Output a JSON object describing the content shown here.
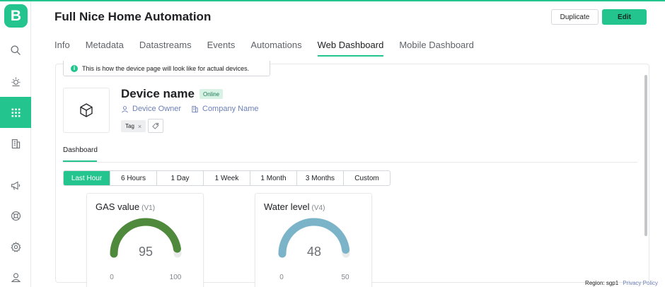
{
  "app": {
    "logo_letter": "B"
  },
  "header": {
    "title": "Full Nice Home Automation",
    "duplicate_label": "Duplicate",
    "edit_label": "Edit"
  },
  "sidebar": {
    "items": [
      {
        "icon": "search-icon"
      },
      {
        "icon": "sun-icon"
      },
      {
        "icon": "grid-icon",
        "active": true
      },
      {
        "icon": "building-icon"
      },
      {
        "icon": "megaphone-icon"
      },
      {
        "icon": "lifebuoy-icon"
      },
      {
        "icon": "gear-icon"
      },
      {
        "icon": "user-icon"
      }
    ],
    "accent": "#23c48e"
  },
  "tabs": [
    {
      "label": "Info"
    },
    {
      "label": "Metadata"
    },
    {
      "label": "Datastreams"
    },
    {
      "label": "Events"
    },
    {
      "label": "Automations"
    },
    {
      "label": "Web Dashboard",
      "active": true
    },
    {
      "label": "Mobile Dashboard"
    }
  ],
  "banner": {
    "text": "This is how the device page will look like for actual devices."
  },
  "device": {
    "name": "Device name",
    "status": "Online",
    "owner": "Device Owner",
    "company": "Company Name",
    "tag": "Tag"
  },
  "dashboard": {
    "tab": "Dashboard",
    "ranges": [
      "Last Hour",
      "6 Hours",
      "1 Day",
      "1 Week",
      "1 Month",
      "3 Months",
      "Custom"
    ],
    "active_range": "Last Hour"
  },
  "widgets": [
    {
      "title": "GAS value",
      "pin": "(V1)",
      "value": "95",
      "min": "0",
      "max": "100",
      "fraction": 0.95,
      "color": "#4f8a3c"
    },
    {
      "title": "Water level",
      "pin": "(V4)",
      "value": "48",
      "min": "0",
      "max": "50",
      "fraction": 0.96,
      "color": "#7bb4c8"
    }
  ],
  "footer": {
    "region": "Region: sgp1",
    "privacy": "Privacy Policy"
  }
}
